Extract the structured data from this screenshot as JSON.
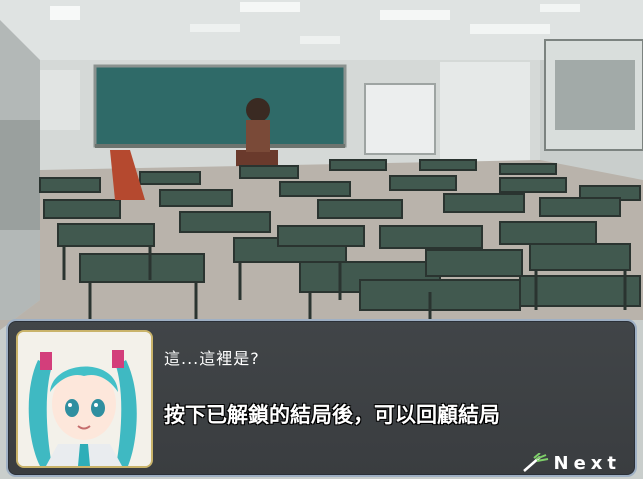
{
  "scene": {
    "background": "classroom-background",
    "colors": {
      "board": "#2f6a68",
      "desk_top": "#41594f",
      "floor": "#b9b3ab",
      "wall": "#cfd4d2"
    }
  },
  "dialog": {
    "portrait": "character-portrait",
    "speaker_line": "這...這裡是?",
    "hint_text": "按下已解鎖的結局後，可以回顧結局",
    "next_label": "Next",
    "next_icon": "leek-icon",
    "colors": {
      "box": "#3f4245",
      "border": "#9fb0c4",
      "portrait_border": "#c9b36a"
    }
  }
}
